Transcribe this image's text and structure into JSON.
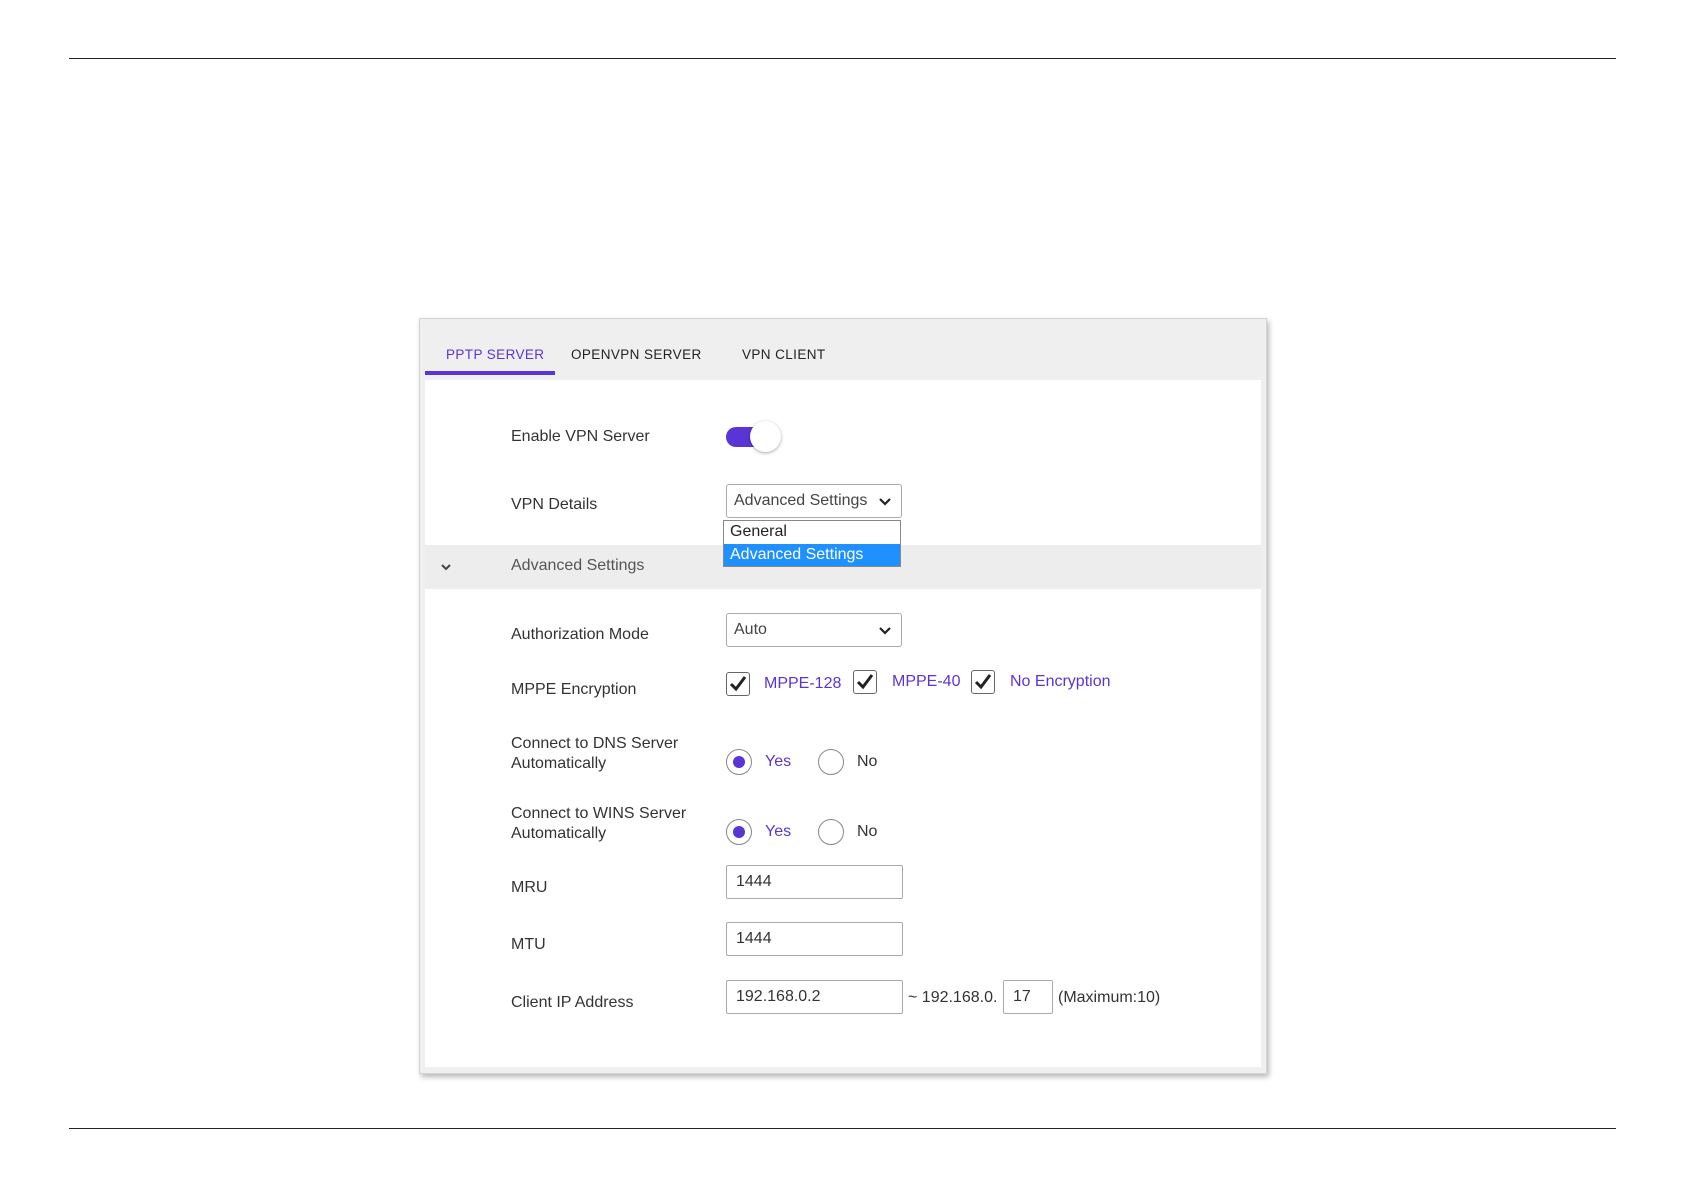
{
  "tabs": [
    {
      "label": "PPTP SERVER",
      "active": true
    },
    {
      "label": "OPENVPN SERVER",
      "active": false
    },
    {
      "label": "VPN CLIENT",
      "active": false
    }
  ],
  "enable_vpn": {
    "label": "Enable VPN Server",
    "on": true
  },
  "vpn_details": {
    "label": "VPN Details",
    "selected": "Advanced Settings",
    "options": [
      "General",
      "Advanced Settings"
    ]
  },
  "advanced": {
    "title": "Advanced Settings"
  },
  "authorization": {
    "label": "Authorization Mode",
    "selected": "Auto"
  },
  "mppe": {
    "label": "MPPE Encryption",
    "options": [
      {
        "label": "MPPE-128",
        "checked": true
      },
      {
        "label": "MPPE-40",
        "checked": true
      },
      {
        "label": "No Encryption",
        "checked": true
      }
    ]
  },
  "dns": {
    "label_line1": "Connect to DNS Server",
    "label_line2": "Automatically",
    "yes": "Yes",
    "no": "No",
    "selected": "Yes"
  },
  "wins": {
    "label_line1": "Connect to WINS Server",
    "label_line2": "Automatically",
    "yes": "Yes",
    "no": "No",
    "selected": "Yes"
  },
  "mru": {
    "label": "MRU",
    "value": "1444"
  },
  "mtu": {
    "label": "MTU",
    "value": "1444"
  },
  "client_ip": {
    "label": "Client IP Address",
    "start": "192.168.0.2",
    "range_prefix": "~ 192.168.0.",
    "end": "17",
    "max_note": "(Maximum:10)"
  },
  "colors": {
    "accent": "#5b34d6",
    "highlight": "#1e90ff"
  },
  "icons": {
    "chevron": "chevron-down-icon",
    "check": "check-icon"
  }
}
